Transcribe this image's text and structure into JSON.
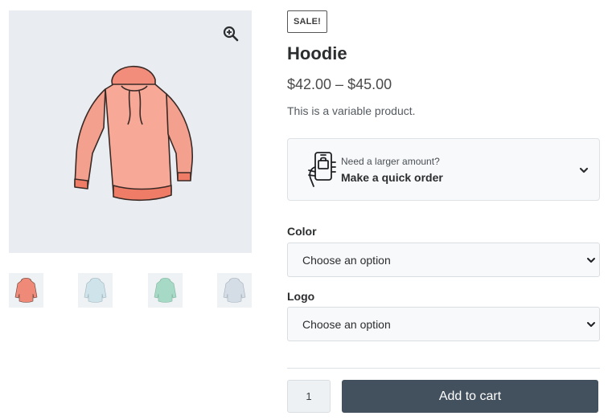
{
  "gallery": {
    "thumbnails": [
      {
        "color": "#f08a78"
      },
      {
        "color": "#cfe3ea"
      },
      {
        "color": "#a6d9c6"
      },
      {
        "color": "#d4dde6"
      }
    ]
  },
  "product": {
    "badge": "SALE!",
    "title": "Hoodie",
    "price": "$42.00 – $45.00",
    "description": "This is a variable product."
  },
  "quick_order": {
    "line1": "Need a larger amount?",
    "line2": "Make a quick order"
  },
  "variations": {
    "color_label": "Color",
    "color_value": "Choose an option",
    "logo_label": "Logo",
    "logo_value": "Choose an option"
  },
  "cart": {
    "quantity": "1",
    "add_label": "Add to cart"
  },
  "colors": {
    "button_bg": "#43505e",
    "image_bg": "#e9edf1",
    "hoodie": "#f08a78"
  }
}
